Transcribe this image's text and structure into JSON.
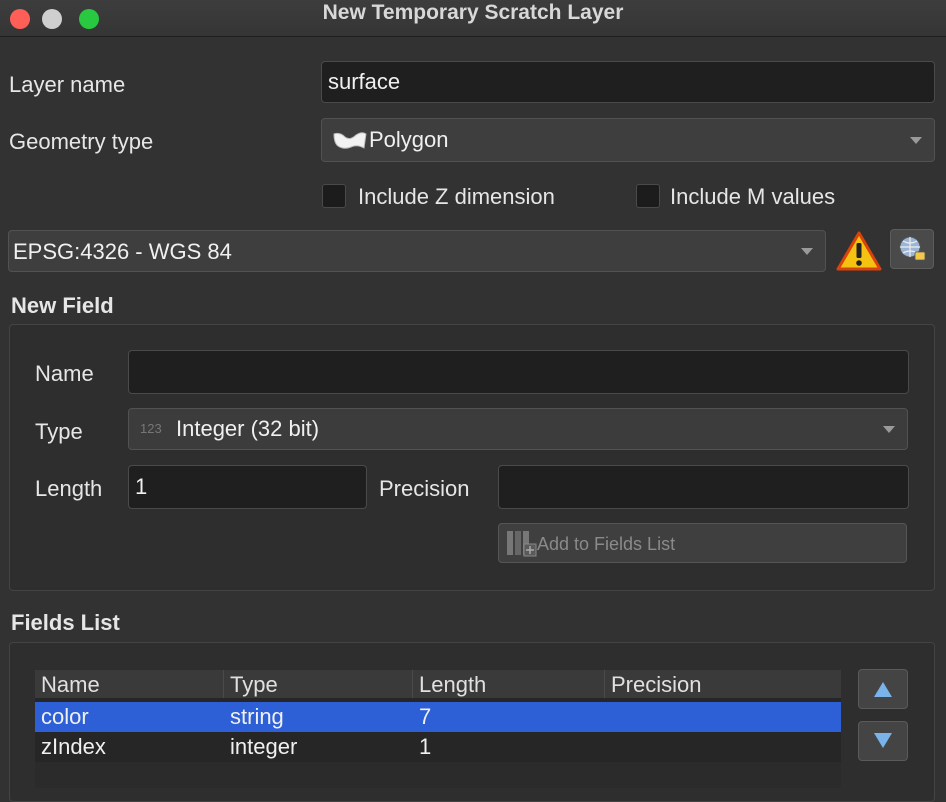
{
  "window": {
    "title": "New Temporary Scratch Layer"
  },
  "layer_name": {
    "label": "Layer name",
    "value": "surface"
  },
  "geometry": {
    "label": "Geometry type",
    "value": "Polygon",
    "icon": "polygon-icon"
  },
  "options": {
    "include_z": "Include Z dimension",
    "include_m": "Include M values"
  },
  "crs": {
    "value": "EPSG:4326 - WGS 84",
    "warning_icon": "warning-icon",
    "selector_icon": "crs-selector-icon"
  },
  "new_field": {
    "title": "New Field",
    "name_label": "Name",
    "name_value": "",
    "type_label": "Type",
    "type_badge": "123",
    "type_value": "Integer (32 bit)",
    "length_label": "Length",
    "length_value": "1",
    "precision_label": "Precision",
    "precision_value": "",
    "add_button": "Add to Fields List"
  },
  "fields_list": {
    "title": "Fields List",
    "columns": [
      "Name",
      "Type",
      "Length",
      "Precision"
    ],
    "rows": [
      {
        "name": "color",
        "type": "string",
        "length": "7",
        "precision": ""
      },
      {
        "name": "zIndex",
        "type": "integer",
        "length": "1",
        "precision": ""
      }
    ],
    "selected_row": 0
  },
  "colors": {
    "accent": "#2d5fd6",
    "warning": "#f5c211"
  }
}
